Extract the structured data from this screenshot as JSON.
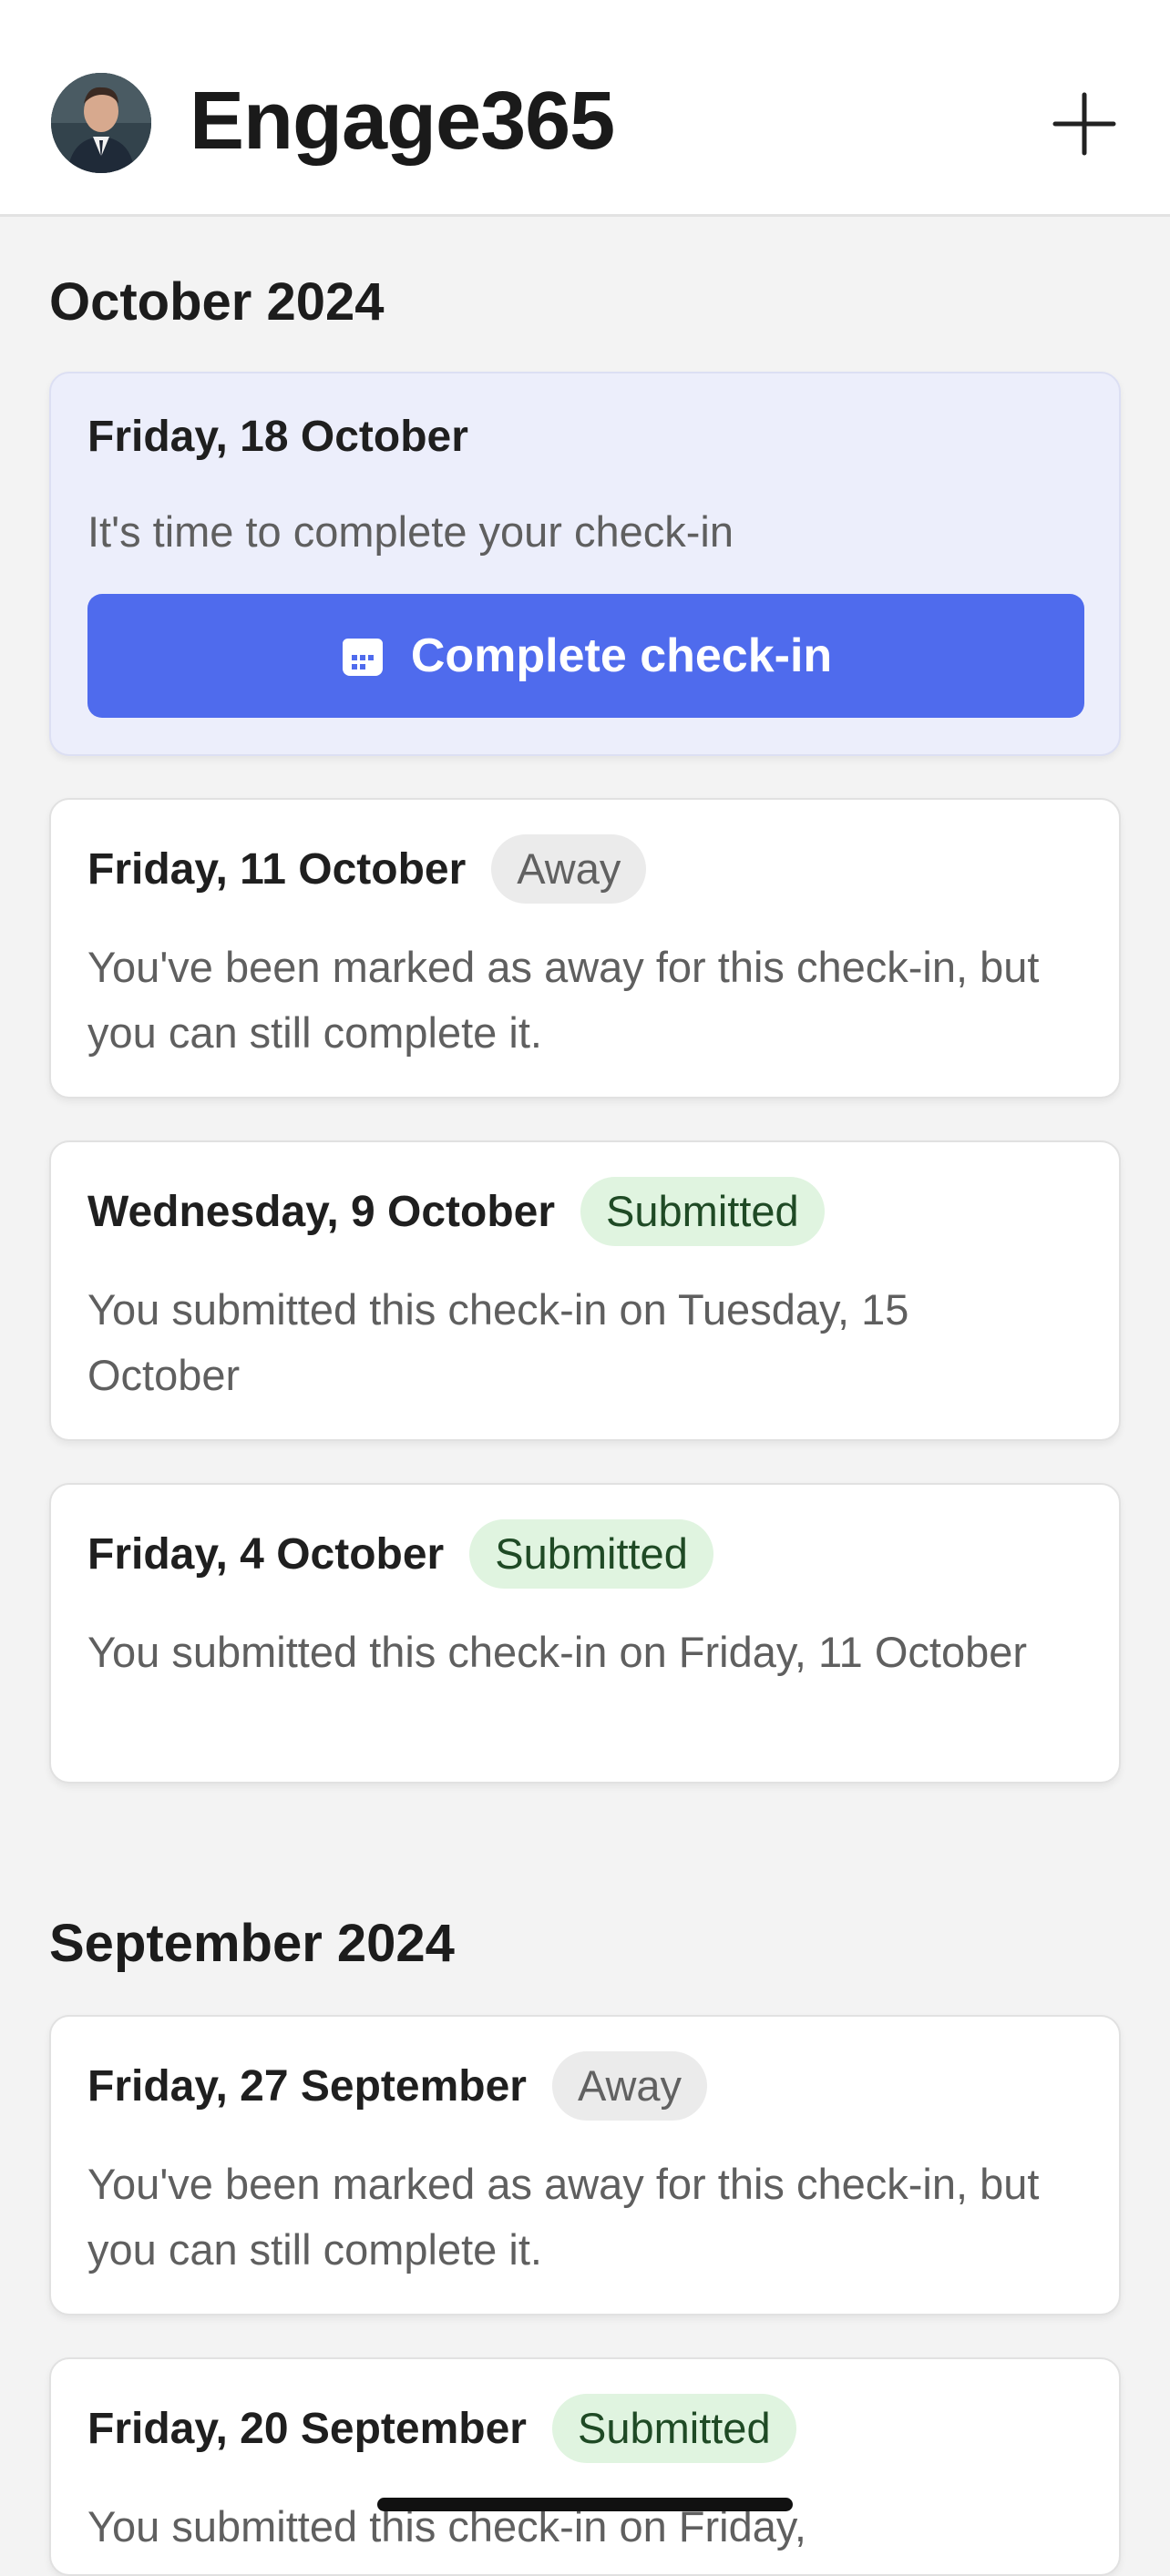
{
  "app": {
    "title": "Engage365"
  },
  "cta": {
    "label": "Complete check-in"
  },
  "months": [
    {
      "label": "October 2024",
      "items": [
        {
          "date": "Friday, 18 October",
          "badge": "",
          "desc": "It's time to complete your check-in"
        },
        {
          "date": "Friday, 11 October",
          "badge": "Away",
          "desc": "You've been marked as away for this check-in, but you can still complete it."
        },
        {
          "date": "Wednesday, 9 October",
          "badge": "Submitted",
          "desc": "You submitted this check-in on Tuesday, 15 October"
        },
        {
          "date": "Friday, 4 October",
          "badge": "Submitted",
          "desc": "You submitted this check-in on Friday, 11 October"
        }
      ]
    },
    {
      "label": "September 2024",
      "items": [
        {
          "date": "Friday, 27 September",
          "badge": "Away",
          "desc": "You've been marked as away for this check-in, but you can still complete it."
        },
        {
          "date": "Friday, 20 September",
          "badge": "Submitted",
          "desc": "You submitted this check-in on Friday,"
        }
      ]
    }
  ],
  "colors": {
    "accent": "#4f6bed",
    "submitted_bg": "#e0f4e0",
    "away_bg": "#ebebeb",
    "active_card_bg": "#eceefb"
  },
  "icons": {
    "add": "plus-icon",
    "cta": "calendar-icon",
    "avatar": "avatar"
  }
}
